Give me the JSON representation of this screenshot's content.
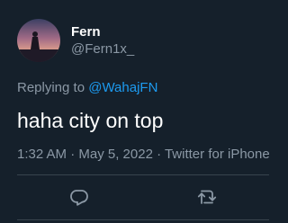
{
  "tweet": {
    "author": {
      "display_name": "Fern",
      "handle": "@Fern1x_"
    },
    "reply_prefix": "Replying to ",
    "reply_to": "@WahajFN",
    "text": "haha city on top",
    "meta": "1:32 AM · May 5, 2022 · Twitter for iPhone"
  },
  "actions": {
    "reply_icon": "reply-icon",
    "retweet_icon": "retweet-icon"
  },
  "colors": {
    "background": "#15202b",
    "text": "#ffffff",
    "secondary_text": "#8b98a5",
    "link": "#1d9bf0",
    "divider": "#38444d"
  }
}
